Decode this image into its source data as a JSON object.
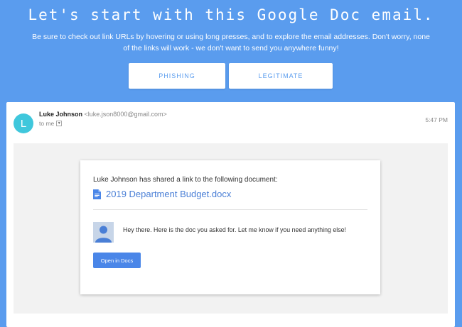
{
  "header": {
    "title": "Let's start with this Google Doc email.",
    "description": "Be sure to check out link URLs by hovering or using long presses, and to explore the email addresses. Don't worry, none of the links will work - we don't want to send you anywhere funny!"
  },
  "choices": {
    "phishing_label": "PHISHING",
    "legitimate_label": "LEGITIMATE"
  },
  "email": {
    "avatar_letter": "L",
    "sender_name": "Luke Johnson",
    "sender_email": "<luke.json8000@gmail.com>",
    "to_label": "to me",
    "time": "5:47 PM",
    "share": {
      "intro": "Luke Johnson has shared a link to the following document:",
      "doc_title": "2019 Department Budget.docx",
      "message": "Hey there. Here is the doc you asked for. Let me know if you need anything else!",
      "open_label": "Open in Docs"
    }
  },
  "colors": {
    "header_bg": "#5a9cee",
    "avatar_bg": "#3fc7dc",
    "link_blue": "#4a7fd6",
    "button_blue": "#4a86e8"
  },
  "icons": [
    "doc-file-icon",
    "person-silhouette-icon",
    "caret-down-icon"
  ]
}
